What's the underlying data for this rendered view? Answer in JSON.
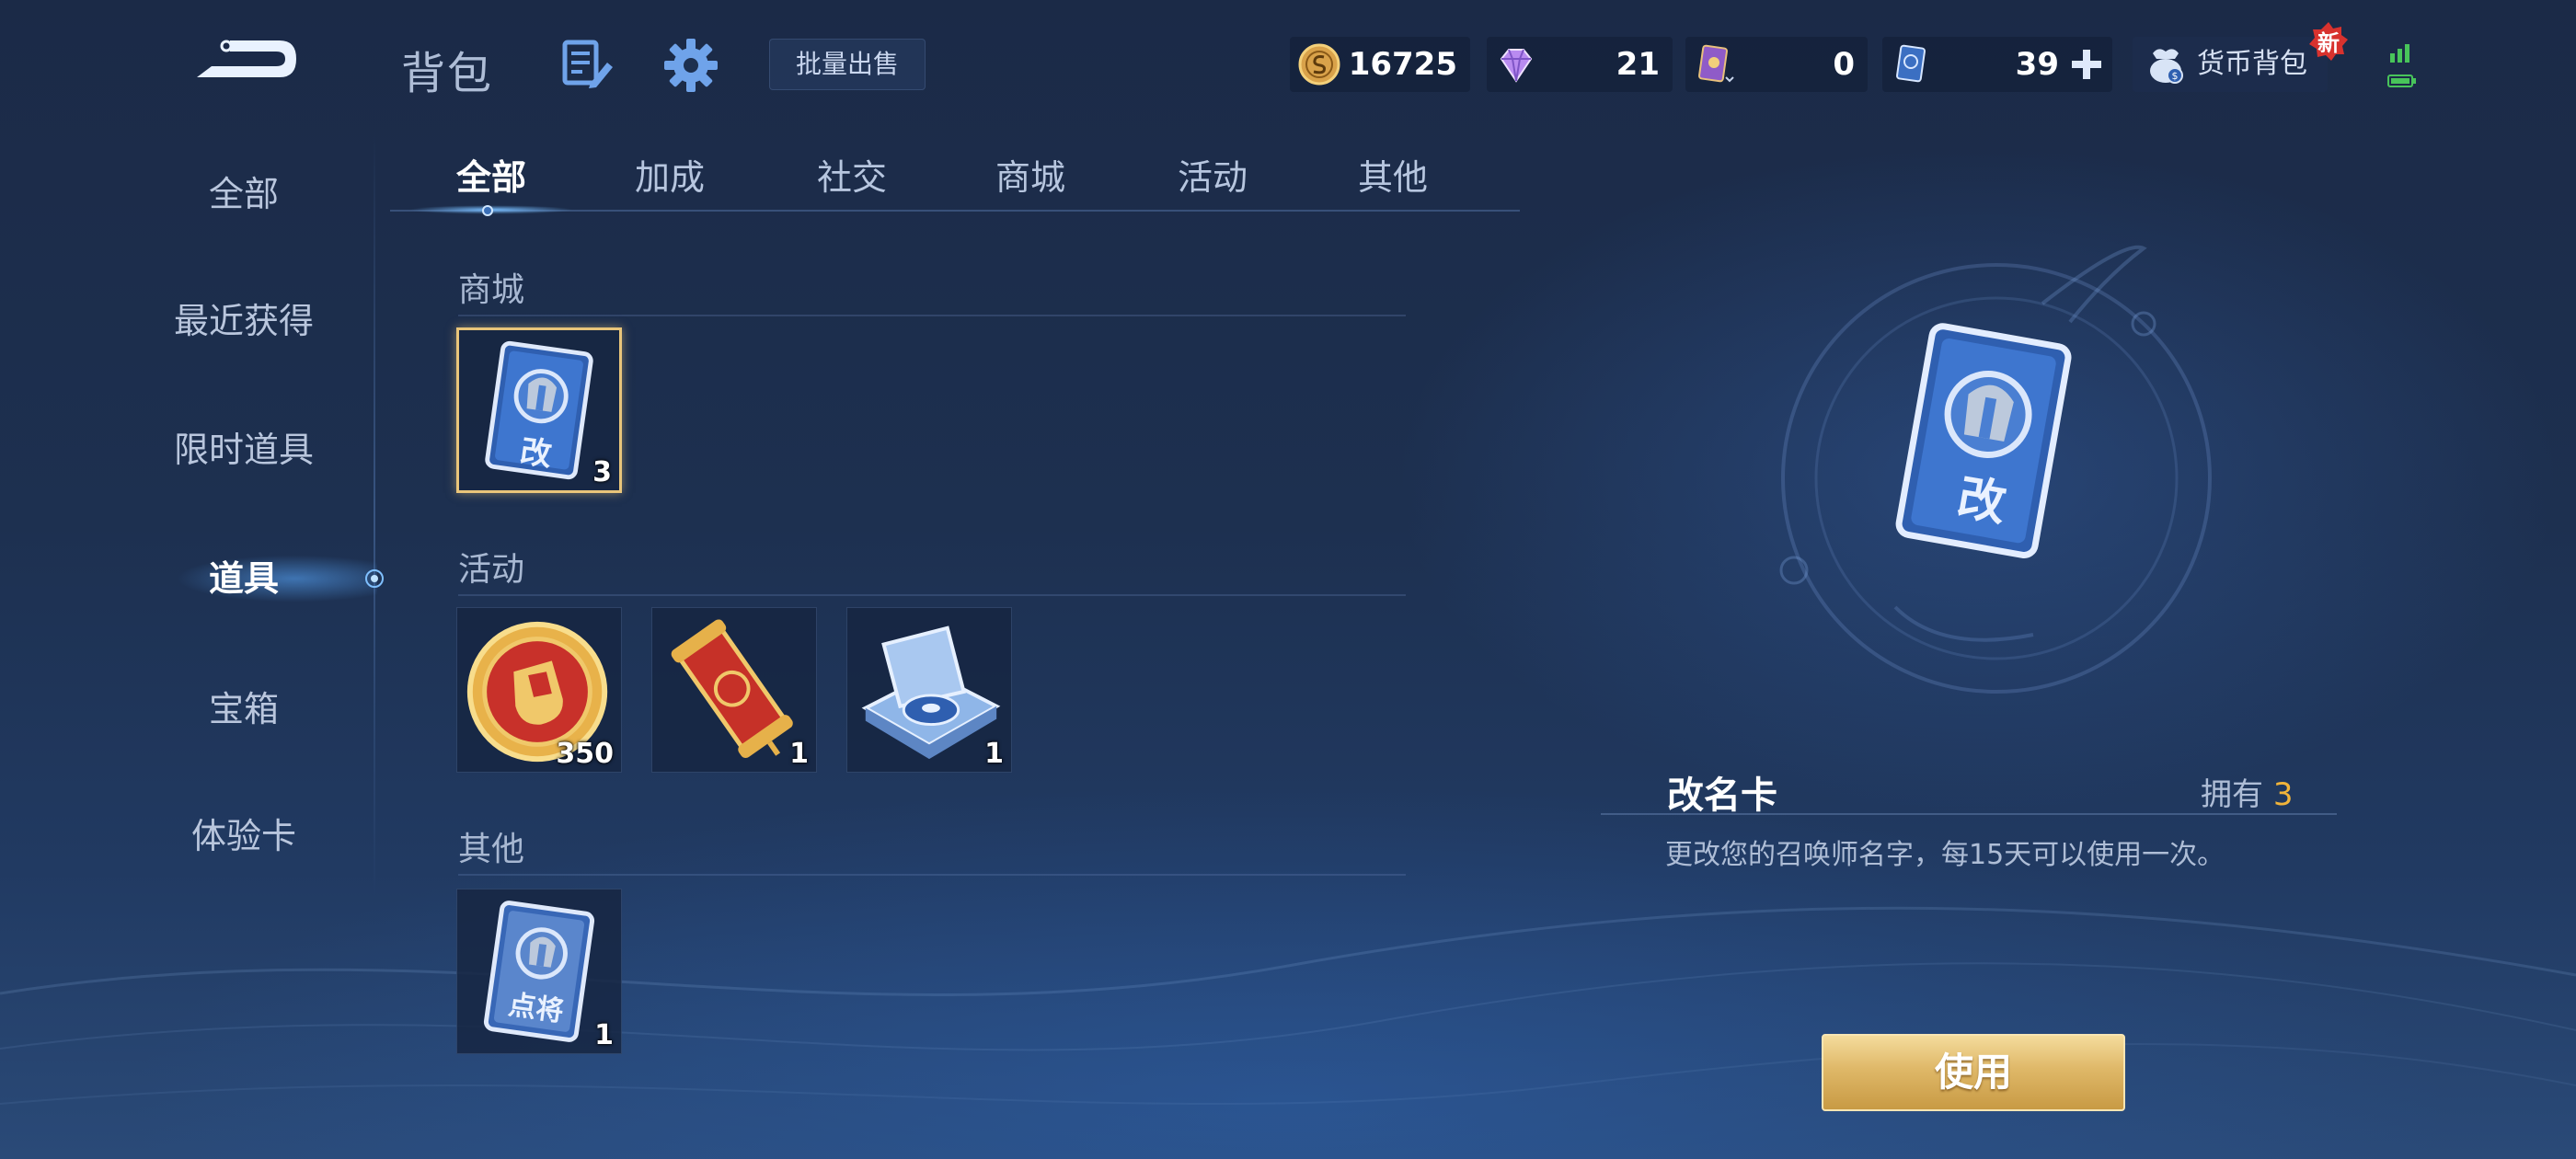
{
  "header": {
    "title": "背包",
    "batch_sell_label": "批量出售",
    "currencies": {
      "gold": "16725",
      "diamond": "21",
      "card": "0",
      "coupon": "39"
    },
    "wallet_label": "货币背包",
    "new_badge": "新"
  },
  "sidebar": {
    "items": [
      {
        "label": "全部"
      },
      {
        "label": "最近获得"
      },
      {
        "label": "限时道具"
      },
      {
        "label": "道具"
      },
      {
        "label": "宝箱"
      },
      {
        "label": "体验卡"
      }
    ],
    "active": "道具"
  },
  "tabs": {
    "items": [
      {
        "label": "全部"
      },
      {
        "label": "加成"
      },
      {
        "label": "社交"
      },
      {
        "label": "商城"
      },
      {
        "label": "活动"
      },
      {
        "label": "其他"
      }
    ],
    "active": "全部"
  },
  "sections": [
    {
      "title": "商城",
      "items": [
        {
          "glyph": "改",
          "count": "3"
        }
      ]
    },
    {
      "title": "活动",
      "items": [
        {
          "count": "350"
        },
        {
          "count": "1"
        },
        {
          "count": "1"
        }
      ]
    },
    {
      "title": "其他",
      "items": [
        {
          "glyph": "点将",
          "count": "1"
        }
      ]
    }
  ],
  "detail": {
    "name": "改名卡",
    "owned_label": "拥有",
    "owned_count": "3",
    "description": "更改您的召唤师名字，每15天可以使用一次。",
    "card_glyph": "改",
    "use_label": "使用"
  },
  "colors": {
    "accent_gold": "#f1b43a",
    "button_gold": "#dfb868",
    "card_blue": "#2f5fb0"
  }
}
